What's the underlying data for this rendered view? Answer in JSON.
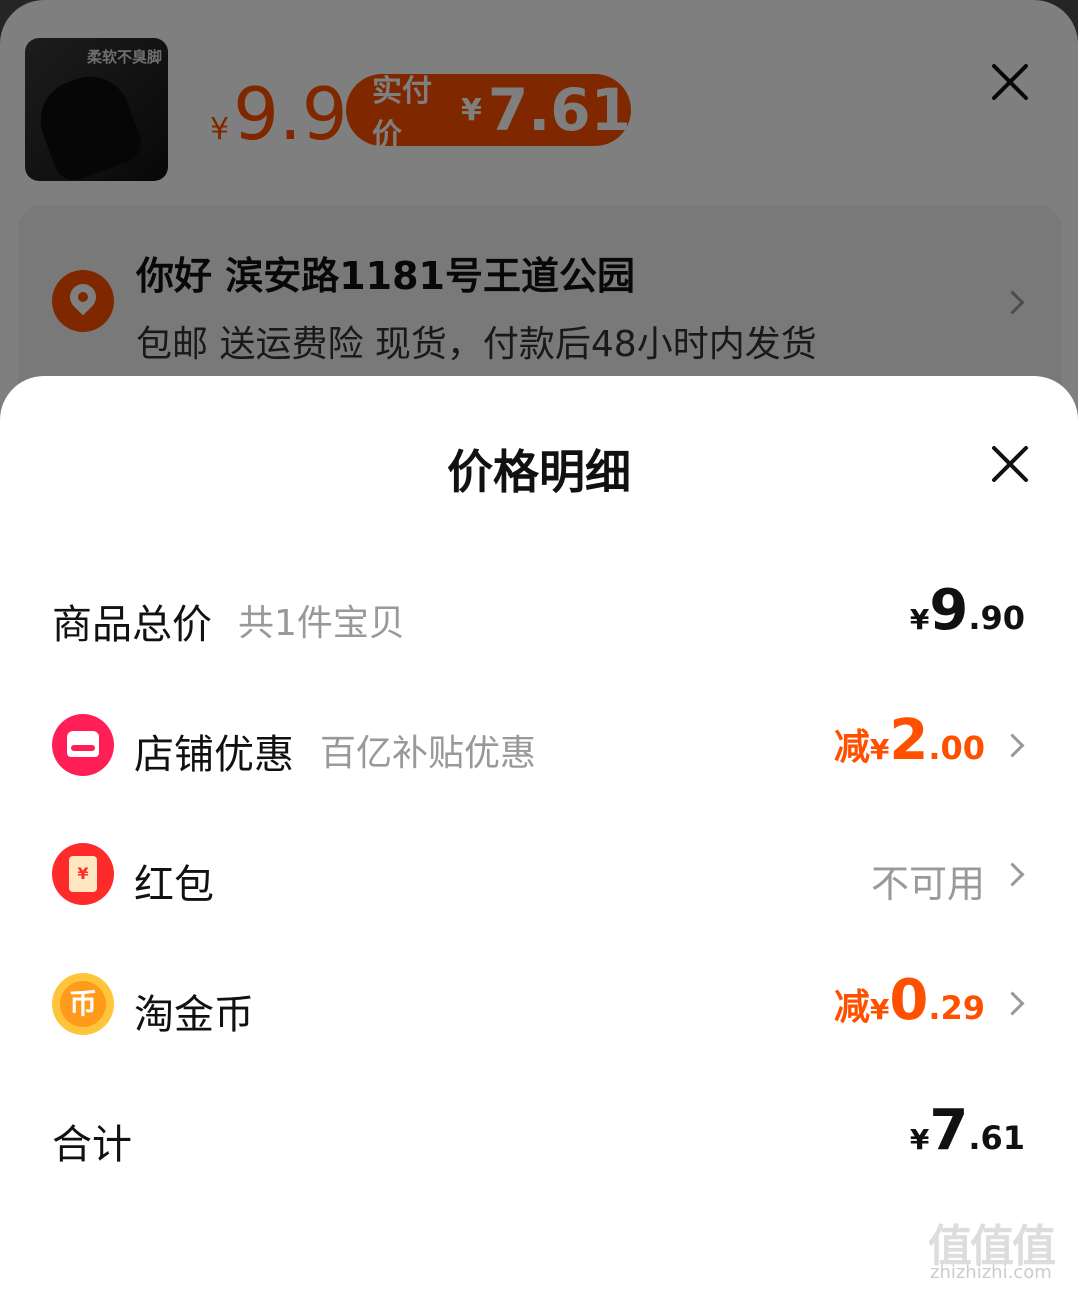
{
  "product": {
    "thumb_tag": "柔软不臭脚",
    "price_currency": "¥",
    "price": "9.9",
    "paid_label": "实付价",
    "paid_currency": "¥",
    "paid_value": "7.61"
  },
  "address": {
    "name_line": "你好 滨安路1181号王道公园",
    "info_line": "包邮  送运费险  现货，付款后48小时内发货"
  },
  "sheet": {
    "title": "价格明细",
    "rows": [
      {
        "label": "商品总价",
        "sub": "共1件宝贝",
        "currency": "¥",
        "int": "9",
        "dec": ".90"
      },
      {
        "label": "店铺优惠",
        "sub": "百亿补贴优惠",
        "prefix": "减",
        "currency": "¥",
        "int": "2",
        "dec": ".00"
      },
      {
        "label": "红包",
        "status": "不可用"
      },
      {
        "label": "淘金币",
        "prefix": "减",
        "currency": "¥",
        "int": "0",
        "dec": ".29"
      },
      {
        "label": "合计",
        "currency": "¥",
        "int": "7",
        "dec": ".61"
      }
    ]
  },
  "icons": {
    "redpacket_glyph": "¥",
    "coin_glyph": "币"
  },
  "watermark": {
    "main": "值值值",
    "sub": "zhizhizhi.com"
  },
  "colors": {
    "accent": "#ff5000",
    "shop_icon": "#ff1e55",
    "redpacket_icon": "#ff2a2a",
    "coin_icon": "#ffc53a"
  }
}
